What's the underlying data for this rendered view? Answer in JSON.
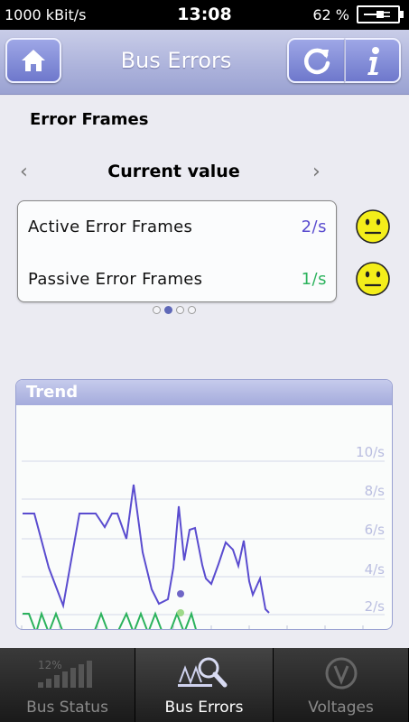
{
  "status_bar": {
    "bitrate": "1000 kBit/s",
    "time": "13:08",
    "battery": "62 %"
  },
  "header": {
    "title": "Bus Errors",
    "icons": {
      "home": "home-icon",
      "refresh": "refresh-icon",
      "info": "info-icon"
    }
  },
  "section": {
    "title": "Error Frames",
    "view_title": "Current value",
    "prev": "‹",
    "next": "›"
  },
  "rows": [
    {
      "label": "Active Error Frames",
      "value": "2/s",
      "color": "#5a4ccf",
      "status_icon": "neutral-face-icon"
    },
    {
      "label": "Passive Error Frames",
      "value": "1/s",
      "color": "#2bb25c",
      "status_icon": "neutral-face-icon"
    }
  ],
  "pager": {
    "count": 4,
    "active": 1
  },
  "trend": {
    "title": "Trend",
    "y_ticks": [
      "10/s",
      "8/s",
      "6/s",
      "4/s",
      "2/s"
    ]
  },
  "tabs": [
    {
      "label": "Bus Status",
      "icon": "signal-bars-icon",
      "badge": "12%",
      "active": false
    },
    {
      "label": "Bus Errors",
      "icon": "magnifier-chart-icon",
      "active": true
    },
    {
      "label": "Voltages",
      "icon": "voltmeter-icon",
      "active": false
    }
  ],
  "colors": {
    "accent": "#8e97d6",
    "active_series": "#5a4ccf",
    "passive_series": "#2bb25c"
  }
}
